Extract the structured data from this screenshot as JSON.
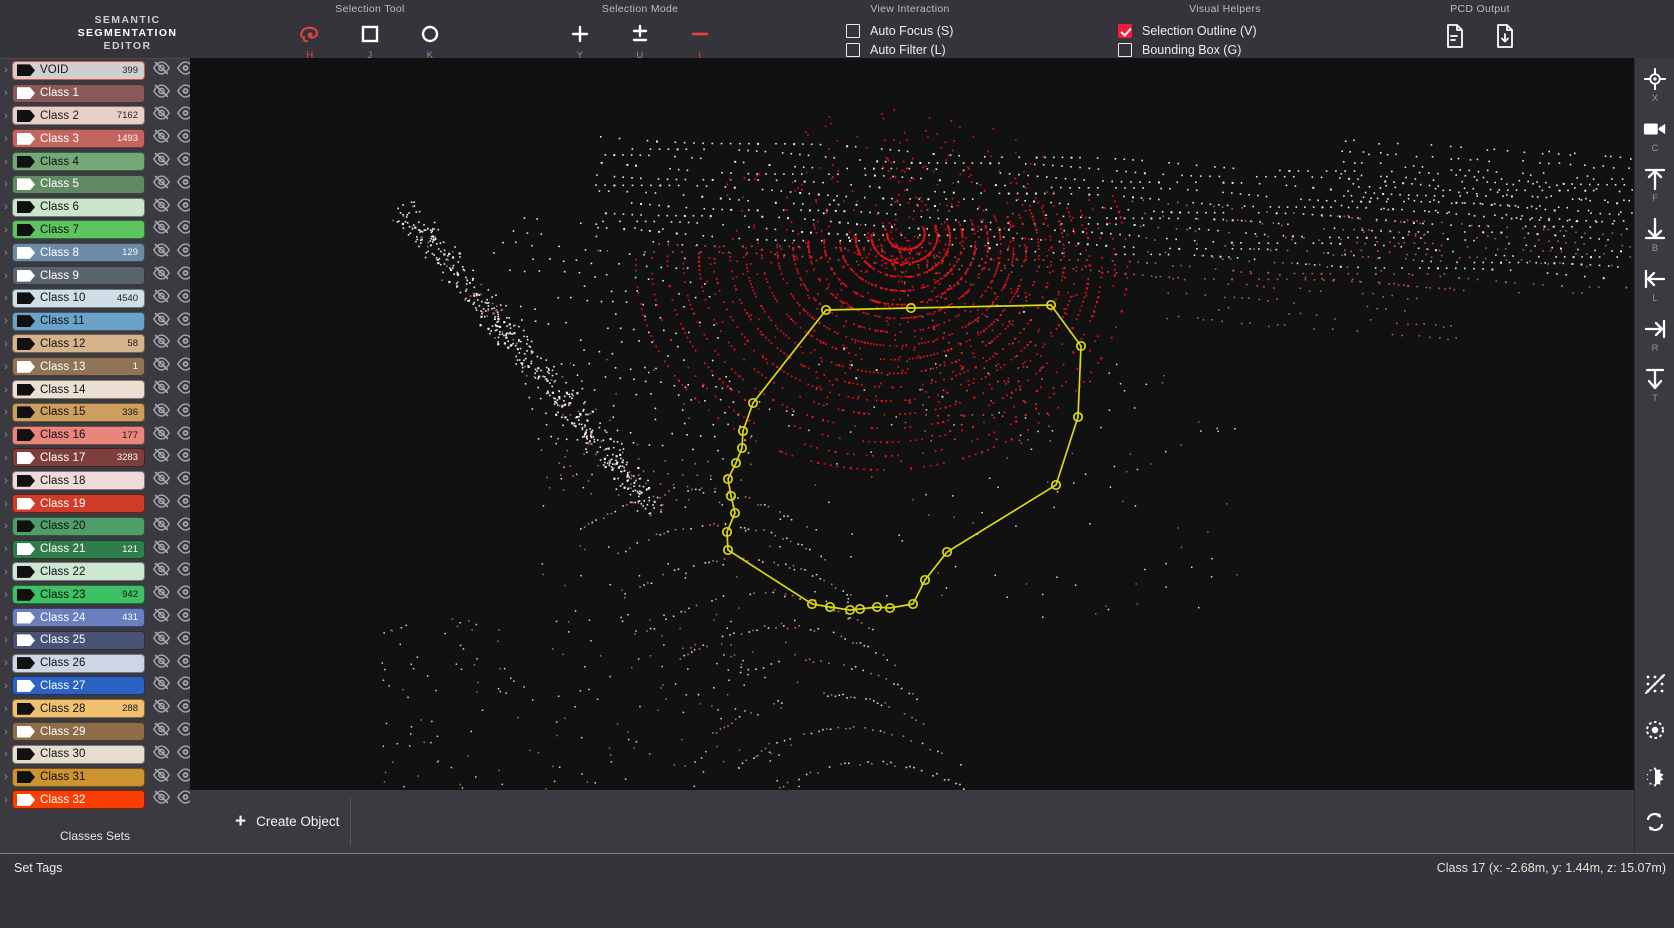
{
  "app": {
    "brand_line1": "SEMANTIC",
    "brand_line2": "SEGMENTATION",
    "brand_line3": "EDITOR",
    "accent_red": "#e8433f",
    "check_red": "#f01e3c",
    "selection_yellow": "#d8d818",
    "viewport_bg": "#111111",
    "panel_bg": "#3a3a40",
    "chrome_bg": "#34343a"
  },
  "toolbar": {
    "selection_tool": {
      "title": "Selection Tool",
      "items": [
        {
          "icon": "lasso-icon",
          "key": "H",
          "active": true
        },
        {
          "icon": "square-icon",
          "key": "J",
          "active": false
        },
        {
          "icon": "circle-icon",
          "key": "K",
          "active": false
        }
      ]
    },
    "selection_mode": {
      "title": "Selection Mode",
      "items": [
        {
          "icon": "plus-icon",
          "key": "Y",
          "active": false
        },
        {
          "icon": "plus-minus-icon",
          "key": "U",
          "active": false
        },
        {
          "icon": "minus-icon",
          "key": "I",
          "active": true
        }
      ]
    },
    "view_interaction": {
      "title": "View Interaction",
      "items": [
        {
          "label": "Auto Focus (S)",
          "checked": false
        },
        {
          "label": "Auto Filter (L)",
          "checked": false
        }
      ]
    },
    "visual_helpers": {
      "title": "Visual Helpers",
      "items": [
        {
          "label": "Selection Outline (V)",
          "checked": true
        },
        {
          "label": "Bounding Box (G)",
          "checked": false
        }
      ]
    },
    "pcd_output": {
      "title": "PCD Output",
      "items": [
        {
          "icon": "file-lines-icon"
        },
        {
          "icon": "file-download-icon"
        }
      ]
    }
  },
  "sidebar": {
    "sets_label": "Classes Sets",
    "expand_caret": "›",
    "eye_off_icon": "eye-off-icon",
    "eye_icon": "eye-icon",
    "classes": [
      {
        "label": "VOID",
        "count": "399",
        "bg": "#cfcfcf",
        "fg": "#1a1a1a",
        "tag": "#111111",
        "selected": true
      },
      {
        "label": "Class 1",
        "count": "",
        "bg": "#8a5a5a",
        "fg": "#ffffff",
        "tag": "#ffffff"
      },
      {
        "label": "Class 2",
        "count": "7162",
        "bg": "#e8cfca",
        "fg": "#1a1a1a",
        "tag": "#111111"
      },
      {
        "label": "Class 3",
        "count": "1493",
        "bg": "#c4645e",
        "fg": "#ffffff",
        "tag": "#ffffff"
      },
      {
        "label": "Class 4",
        "count": "",
        "bg": "#74a877",
        "fg": "#111111",
        "tag": "#111111"
      },
      {
        "label": "Class 5",
        "count": "",
        "bg": "#5f8a62",
        "fg": "#ffffff",
        "tag": "#ffffff"
      },
      {
        "label": "Class 6",
        "count": "",
        "bg": "#cbe6cc",
        "fg": "#111111",
        "tag": "#111111"
      },
      {
        "label": "Class 7",
        "count": "",
        "bg": "#5ec45f",
        "fg": "#111111",
        "tag": "#111111"
      },
      {
        "label": "Class 8",
        "count": "129",
        "bg": "#6d8ba6",
        "fg": "#ffffff",
        "tag": "#ffffff"
      },
      {
        "label": "Class 9",
        "count": "",
        "bg": "#5a646e",
        "fg": "#ffffff",
        "tag": "#ffffff"
      },
      {
        "label": "Class 10",
        "count": "4540",
        "bg": "#cfdfe8",
        "fg": "#111111",
        "tag": "#111111"
      },
      {
        "label": "Class 11",
        "count": "",
        "bg": "#6ba2c8",
        "fg": "#111111",
        "tag": "#111111"
      },
      {
        "label": "Class 12",
        "count": "58",
        "bg": "#d5b48b",
        "fg": "#111111",
        "tag": "#111111"
      },
      {
        "label": "Class 13",
        "count": "1",
        "bg": "#8f7458",
        "fg": "#ffffff",
        "tag": "#ffffff"
      },
      {
        "label": "Class 14",
        "count": "",
        "bg": "#eadfd2",
        "fg": "#111111",
        "tag": "#111111"
      },
      {
        "label": "Class 15",
        "count": "336",
        "bg": "#cc9f5f",
        "fg": "#111111",
        "tag": "#111111"
      },
      {
        "label": "Class 16",
        "count": "177",
        "bg": "#e8867b",
        "fg": "#111111",
        "tag": "#111111"
      },
      {
        "label": "Class 17",
        "count": "3283",
        "bg": "#7e3f3c",
        "fg": "#ffffff",
        "tag": "#ffffff"
      },
      {
        "label": "Class 18",
        "count": "",
        "bg": "#eedada",
        "fg": "#111111",
        "tag": "#111111"
      },
      {
        "label": "Class 19",
        "count": "",
        "bg": "#d13c28",
        "fg": "#ffffff",
        "tag": "#ffffff"
      },
      {
        "label": "Class 20",
        "count": "",
        "bg": "#4f9e6a",
        "fg": "#111111",
        "tag": "#111111"
      },
      {
        "label": "Class 21",
        "count": "121",
        "bg": "#2f7d4a",
        "fg": "#ffffff",
        "tag": "#ffffff"
      },
      {
        "label": "Class 22",
        "count": "",
        "bg": "#cce6d2",
        "fg": "#111111",
        "tag": "#111111"
      },
      {
        "label": "Class 23",
        "count": "942",
        "bg": "#3ec165",
        "fg": "#111111",
        "tag": "#111111"
      },
      {
        "label": "Class 24",
        "count": "431",
        "bg": "#6a7fc0",
        "fg": "#ffffff",
        "tag": "#ffffff"
      },
      {
        "label": "Class 25",
        "count": "",
        "bg": "#4a5275",
        "fg": "#ffffff",
        "tag": "#ffffff"
      },
      {
        "label": "Class 26",
        "count": "",
        "bg": "#ced5e4",
        "fg": "#111111",
        "tag": "#111111"
      },
      {
        "label": "Class 27",
        "count": "",
        "bg": "#2a63c4",
        "fg": "#ffffff",
        "tag": "#ffffff"
      },
      {
        "label": "Class 28",
        "count": "288",
        "bg": "#eec070",
        "fg": "#111111",
        "tag": "#111111"
      },
      {
        "label": "Class 29",
        "count": "",
        "bg": "#8d6c47",
        "fg": "#ffffff",
        "tag": "#ffffff"
      },
      {
        "label": "Class 30",
        "count": "",
        "bg": "#e6ddcf",
        "fg": "#111111",
        "tag": "#111111"
      },
      {
        "label": "Class 31",
        "count": "",
        "bg": "#cc9330",
        "fg": "#111111",
        "tag": "#111111"
      },
      {
        "label": "Class 32",
        "count": "",
        "bg": "#fa3f05",
        "fg": "#ffffff",
        "tag": "#ffffff"
      }
    ]
  },
  "actionbar": {
    "create_object_label": "Create Object",
    "plus_glyph": "+"
  },
  "rail": {
    "items": [
      {
        "icon": "crosshair-target-icon",
        "key": "X"
      },
      {
        "icon": "camera-icon",
        "key": "C"
      },
      {
        "icon": "arrow-up-to-bar-icon",
        "key": "F"
      },
      {
        "icon": "arrow-down-to-bar-icon",
        "key": "B"
      },
      {
        "icon": "arrow-left-to-bar-icon",
        "key": "L"
      },
      {
        "icon": "arrow-right-to-bar-icon",
        "key": "R"
      },
      {
        "icon": "arrow-down-from-bar-icon",
        "key": "T"
      }
    ],
    "bottom_items": [
      {
        "icon": "grid-dots-off-icon"
      },
      {
        "icon": "focus-ring-icon"
      },
      {
        "icon": "brightness-contrast-icon"
      },
      {
        "icon": "sync-refresh-icon"
      }
    ]
  },
  "statusbar": {
    "set_tags_label": "Set Tags",
    "coords": "Class 17 (x: -2.68m, y: 1.44m, z: 15.07m)"
  }
}
